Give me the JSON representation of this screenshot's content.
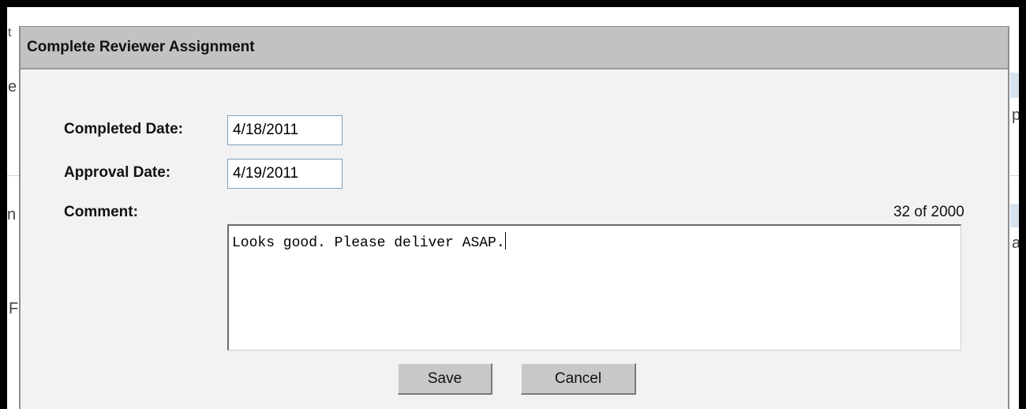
{
  "dialog": {
    "title": "Complete Reviewer Assignment",
    "completed_date": {
      "label": "Completed Date:",
      "value": "4/18/2011"
    },
    "approval_date": {
      "label": "Approval Date:",
      "value": "4/19/2011"
    },
    "comment": {
      "label": "Comment:",
      "counter": "32 of 2000",
      "value": "Looks good. Please deliver ASAP."
    },
    "buttons": {
      "save": "Save",
      "cancel": "Cancel"
    }
  },
  "background_fragments": [
    "t",
    "e",
    "n",
    "F",
    "p",
    "a"
  ]
}
